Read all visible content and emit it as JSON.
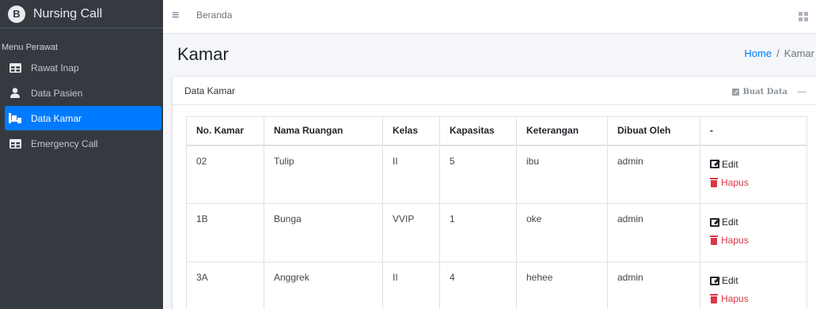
{
  "brand": {
    "logo_letter": "B",
    "name": "Nursing Call"
  },
  "sidebar": {
    "header": "Menu Perawat",
    "items": [
      {
        "label": "Rawat Inap",
        "icon": "table-icon",
        "active": false
      },
      {
        "label": "Data Pasien",
        "icon": "user-icon",
        "active": false
      },
      {
        "label": "Data Kamar",
        "icon": "bed-icon",
        "active": true
      },
      {
        "label": "Emergency Call",
        "icon": "table-icon",
        "active": false
      }
    ]
  },
  "topbar": {
    "menu_icon": "hamburger-icon",
    "link": "Beranda",
    "apps_icon": "grid-icon"
  },
  "page": {
    "title": "Kamar",
    "breadcrumb": {
      "home": "Home",
      "separator": "/",
      "current": "Kamar"
    }
  },
  "card": {
    "title": "Data Kamar",
    "create_label": "Buat Data",
    "collapse_label": "—"
  },
  "table": {
    "headers": [
      "No. Kamar",
      "Nama Ruangan",
      "Kelas",
      "Kapasitas",
      "Keterangan",
      "Dibuat Oleh",
      "-"
    ],
    "rows": [
      {
        "no": "02",
        "nama": "Tulip",
        "kelas": "II",
        "kapasitas": "5",
        "keterangan": "ibu",
        "oleh": "admin"
      },
      {
        "no": "1B",
        "nama": "Bunga",
        "kelas": "VVIP",
        "kapasitas": "1",
        "keterangan": "oke",
        "oleh": "admin"
      },
      {
        "no": "3A",
        "nama": "Anggrek",
        "kelas": "II",
        "kapasitas": "4",
        "keterangan": "hehee",
        "oleh": "admin"
      }
    ],
    "edit_label": "Edit",
    "delete_label": "Hapus"
  },
  "colors": {
    "sidebar_bg": "#343a40",
    "accent": "#007bff",
    "danger": "#dc3545"
  }
}
